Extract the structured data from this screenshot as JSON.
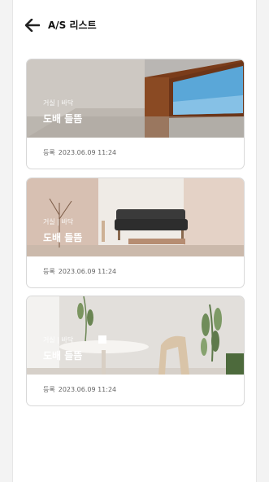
{
  "header": {
    "title": "A/S 리스트"
  },
  "cards": [
    {
      "category": "거실 | 바닥",
      "title": "도배 들뜸",
      "date_label": "등록",
      "date": "2023.06.09 11:24",
      "image": "room-window-photo"
    },
    {
      "category": "거실 | 바닥",
      "title": "도배 들뜸",
      "date_label": "등록",
      "date": "2023.06.09 11:24",
      "image": "living-room-sofa-photo"
    },
    {
      "category": "거실 | 바닥",
      "title": "도배 들뜸",
      "date_label": "등록",
      "date": "2023.06.09 11:24",
      "image": "dining-table-plant-photo"
    }
  ],
  "icons": {
    "back": "arrow-left-icon"
  }
}
